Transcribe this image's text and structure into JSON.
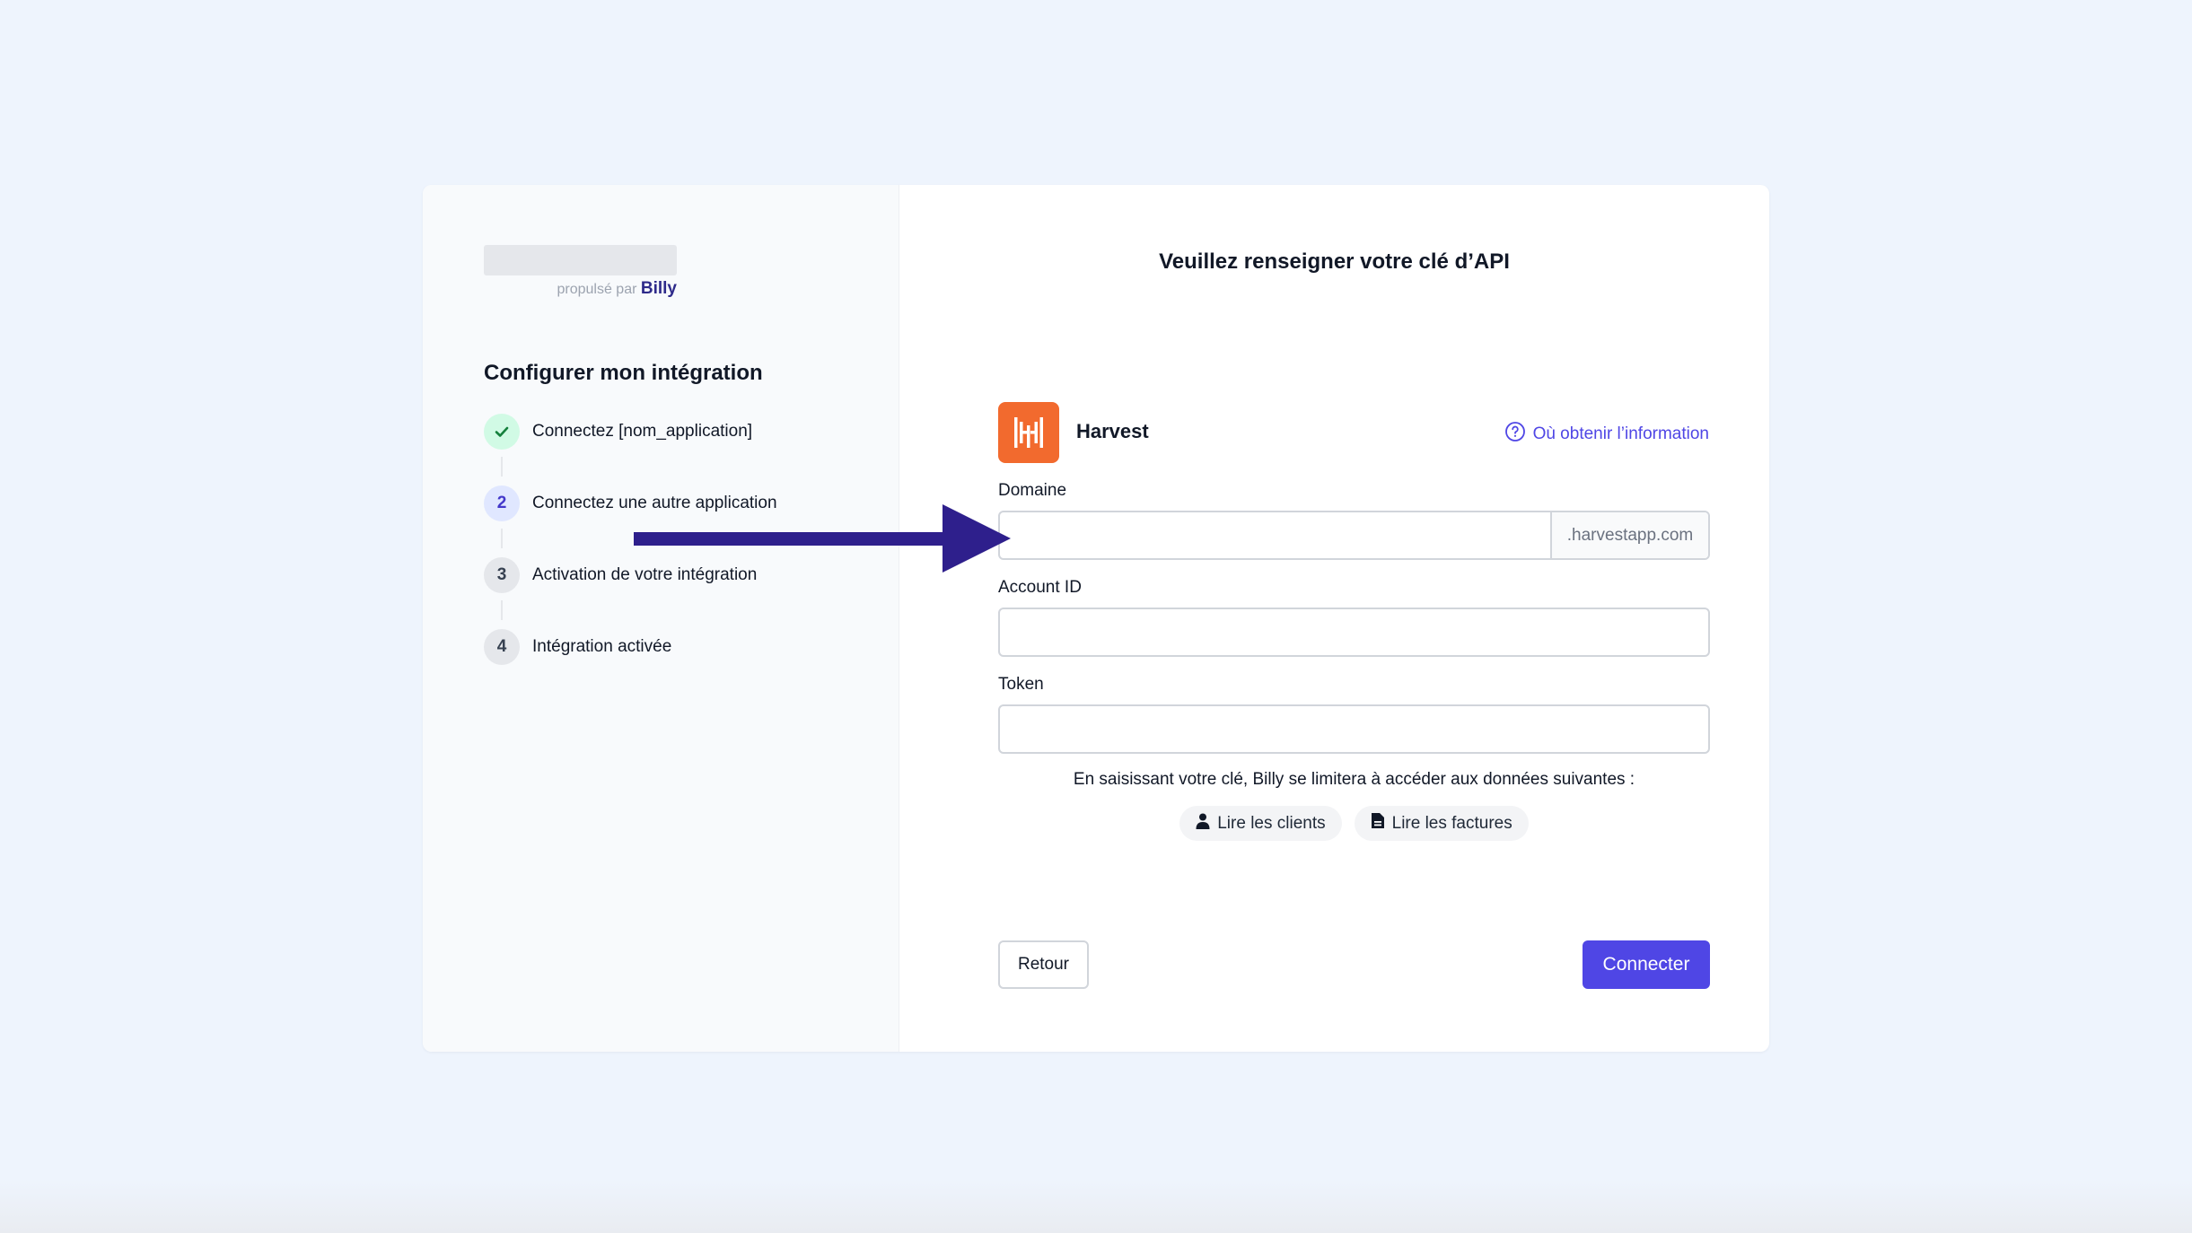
{
  "colors": {
    "accent": "#4f46e5",
    "arrow": "#2e1f8c",
    "harvest_orange": "#f26a2e",
    "success": "#15803d"
  },
  "sidebar": {
    "powered_by": "propulsé par",
    "brand": "Billy",
    "title": "Configurer mon intégration",
    "steps": [
      {
        "marker": "check-icon",
        "label": "Connectez [nom_application]",
        "state": "done"
      },
      {
        "marker": "2",
        "label": "Connectez une autre application",
        "state": "active"
      },
      {
        "marker": "3",
        "label": "Activation de votre intégration",
        "state": "todo"
      },
      {
        "marker": "4",
        "label": "Intégration activée",
        "state": "todo"
      }
    ]
  },
  "main": {
    "title": "Veuillez renseigner votre clé d’API",
    "app_name": "Harvest",
    "help_link": "Où obtenir l’information",
    "fields": {
      "domain": {
        "label": "Domaine",
        "value": "",
        "suffix": ".harvestapp.com"
      },
      "account_id": {
        "label": "Account ID",
        "value": ""
      },
      "token": {
        "label": "Token",
        "value": ""
      }
    },
    "info": "En saisissant votre clé, Billy se limitera à accéder aux données suivantes :",
    "permissions": [
      {
        "icon": "user-icon",
        "label": "Lire les clients"
      },
      {
        "icon": "document-icon",
        "label": "Lire les factures"
      }
    ],
    "back_label": "Retour",
    "connect_label": "Connecter"
  }
}
